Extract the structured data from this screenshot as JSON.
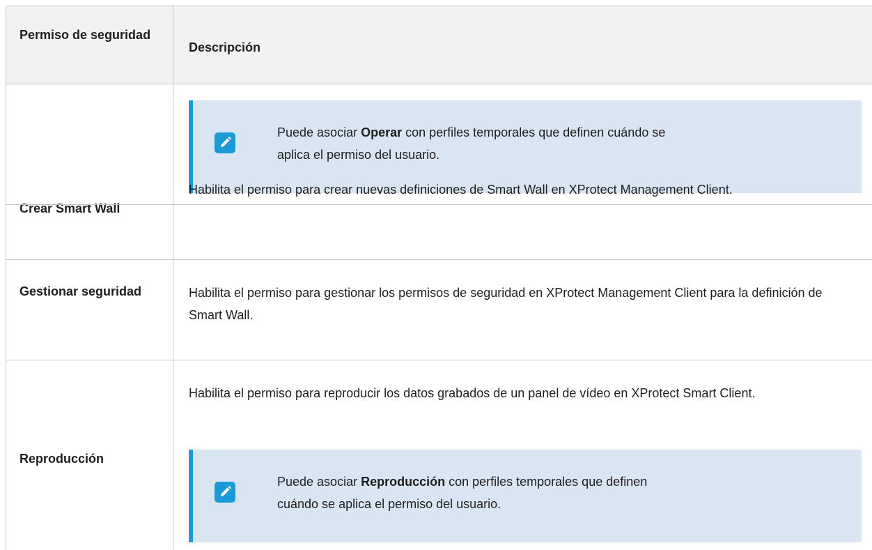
{
  "header": {
    "col1": "Permiso de seguridad",
    "col2": "Descripción"
  },
  "rows": [
    {
      "permission": "",
      "note": {
        "prefix": "Puede asociar ",
        "bold": "Operar",
        "suffix": " con perfiles temporales que definen cuándo se aplica el permiso del usuario."
      }
    },
    {
      "permission": "Crear Smart Wall",
      "description": "Habilita el permiso para crear nuevas definiciones de Smart Wall en XProtect Management Client."
    },
    {
      "permission": "Gestionar seguridad",
      "description": "Habilita el permiso para gestionar los permisos de seguridad en XProtect Management Client para la definición de Smart Wall."
    },
    {
      "permission": "Reproducción",
      "description": "Habilita el permiso para reproducir los datos grabados de un panel de vídeo en XProtect Smart Client.",
      "note": {
        "prefix": "Puede asociar ",
        "bold": "Reproducción",
        "suffix": " con perfiles temporales que definen cuándo se aplica el permiso del usuario."
      }
    }
  ],
  "icons": {
    "note": "pencil-edit-icon"
  },
  "colors": {
    "accent": "#1a9ad6",
    "note_bg": "#d9e5f3",
    "header_bg": "#f2f2f2"
  }
}
